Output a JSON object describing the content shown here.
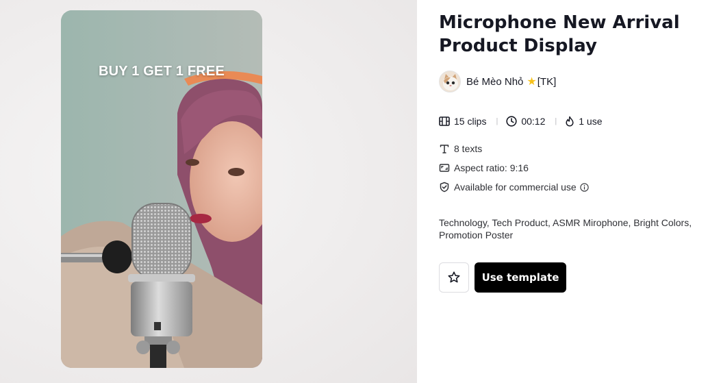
{
  "preview": {
    "overlay_text": "BUY 1 GET 1 FREE"
  },
  "template": {
    "title": "Microphone New Arrival Product Display"
  },
  "author": {
    "name": "Bé Mèo Nhỏ",
    "badge_icon": "star-icon",
    "suffix": "[TK]"
  },
  "stats": {
    "clips": "15 clips",
    "duration": "00:12",
    "uses": "1 use"
  },
  "meta": {
    "texts": "8 texts",
    "aspect_ratio": "Aspect ratio: 9:16",
    "commercial": "Available for commercial use"
  },
  "tags": "Technology, Tech Product, ASMR Mirophone, Bright Colors, Promotion Poster",
  "actions": {
    "favorite_icon": "star-outline-icon",
    "use_template_label": "Use template"
  },
  "colors": {
    "primary_button": "#000000",
    "text": "#161823",
    "star": "#f7c21c"
  }
}
